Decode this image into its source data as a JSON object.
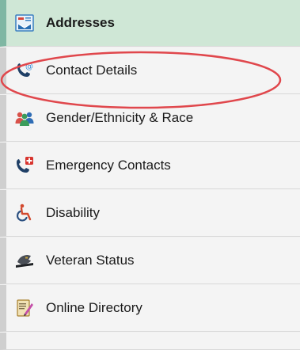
{
  "menu": {
    "items": [
      {
        "label": "Addresses",
        "icon": "address-card-icon"
      },
      {
        "label": "Contact Details",
        "icon": "phone-email-icon"
      },
      {
        "label": "Gender/Ethnicity & Race",
        "icon": "people-group-icon"
      },
      {
        "label": "Emergency Contacts",
        "icon": "emergency-phone-icon"
      },
      {
        "label": "Disability",
        "icon": "wheelchair-icon"
      },
      {
        "label": "Veteran Status",
        "icon": "veteran-hat-icon"
      },
      {
        "label": "Online Directory",
        "icon": "directory-book-icon"
      }
    ]
  },
  "colors": {
    "active_bg": "#cfe7d6",
    "active_border": "#7fb7a3",
    "annotation_red": "#e0474c"
  }
}
